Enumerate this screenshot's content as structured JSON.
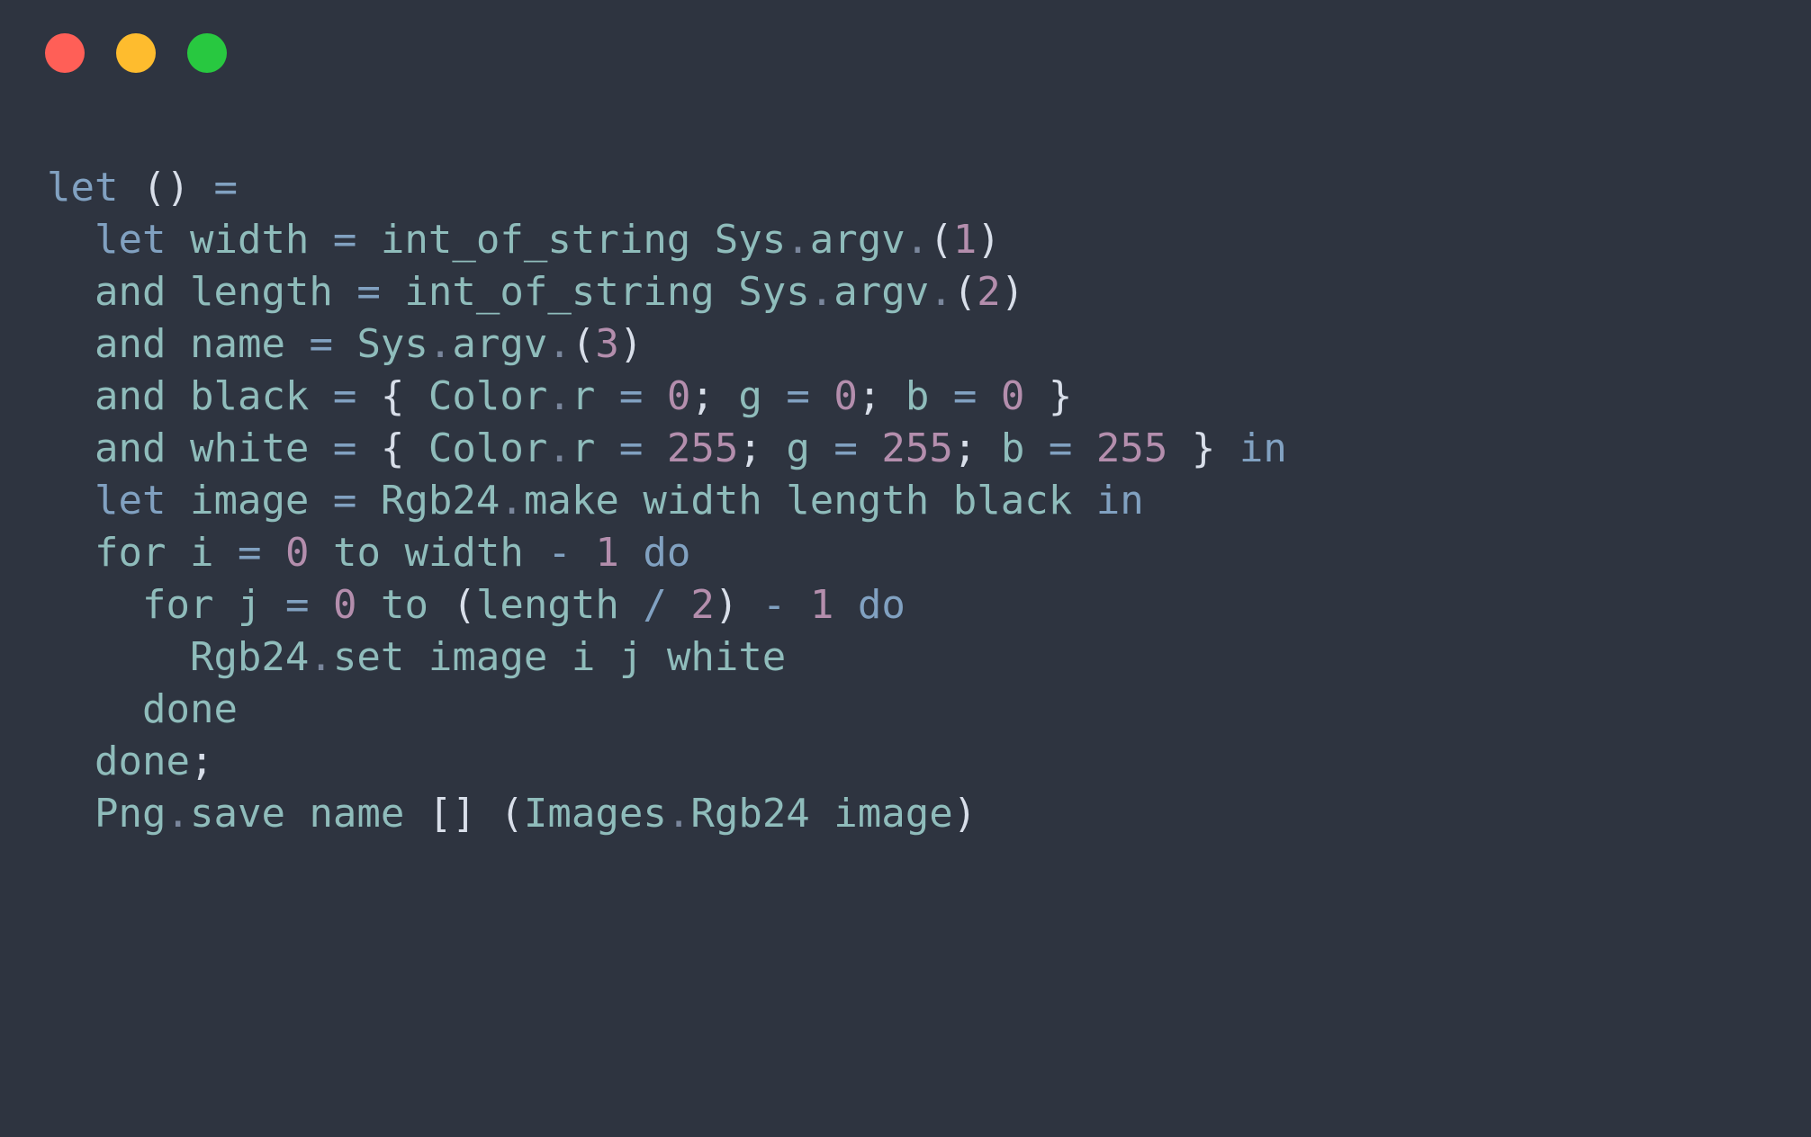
{
  "window": {
    "title": "",
    "background_color": "#2e3440",
    "controls": [
      {
        "name": "close",
        "color": "#ff5f57",
        "label": ""
      },
      {
        "name": "minimize",
        "color": "#febc2e",
        "label": ""
      },
      {
        "name": "maximize",
        "color": "#28c840",
        "label": ""
      }
    ]
  },
  "editor": {
    "language": "OCaml",
    "palette": {
      "background": "#2e3440",
      "keyword": "#81a1c1",
      "identifier": "#8fbcbb",
      "number": "#b48ead",
      "punctuation": "#d8dee9",
      "operator": "#81a1c1"
    },
    "code_plain": "let () =\n  let width = int_of_string Sys.argv.(1)\n  and length = int_of_string Sys.argv.(2)\n  and name = Sys.argv.(3)\n  and black = { Color.r = 0; g = 0; b = 0 }\n  and white = { Color.r = 255; g = 255; b = 255 } in\n  let image = Rgb24.make width length black in\n  for i = 0 to width - 1 do\n    for j = 0 to (length / 2) - 1 do\n      Rgb24.set image i j white\n    done\n  done;\n  Png.save name [] (Images.Rgb24 image)",
    "lines": [
      {
        "n": 1,
        "text": "let () =",
        "tokens": [
          {
            "t": "let",
            "c": "kw"
          },
          {
            "t": " ",
            "c": "plain"
          },
          {
            "t": "()",
            "c": "punc"
          },
          {
            "t": " ",
            "c": "plain"
          },
          {
            "t": "=",
            "c": "op"
          }
        ]
      },
      {
        "n": 2,
        "text": "  let width = int_of_string Sys.argv.(1)",
        "tokens": [
          {
            "t": "  ",
            "c": "plain"
          },
          {
            "t": "let",
            "c": "kw"
          },
          {
            "t": " ",
            "c": "plain"
          },
          {
            "t": "width",
            "c": "id"
          },
          {
            "t": " ",
            "c": "plain"
          },
          {
            "t": "=",
            "c": "op"
          },
          {
            "t": " ",
            "c": "plain"
          },
          {
            "t": "int_of_string",
            "c": "id"
          },
          {
            "t": " ",
            "c": "plain"
          },
          {
            "t": "Sys",
            "c": "id"
          },
          {
            "t": ".",
            "c": "dot"
          },
          {
            "t": "argv",
            "c": "id"
          },
          {
            "t": ".",
            "c": "dot"
          },
          {
            "t": "(",
            "c": "punc"
          },
          {
            "t": "1",
            "c": "num"
          },
          {
            "t": ")",
            "c": "punc"
          }
        ]
      },
      {
        "n": 3,
        "text": "  and length = int_of_string Sys.argv.(2)",
        "tokens": [
          {
            "t": "  ",
            "c": "plain"
          },
          {
            "t": "and",
            "c": "id"
          },
          {
            "t": " ",
            "c": "plain"
          },
          {
            "t": "length",
            "c": "id"
          },
          {
            "t": " ",
            "c": "plain"
          },
          {
            "t": "=",
            "c": "op"
          },
          {
            "t": " ",
            "c": "plain"
          },
          {
            "t": "int_of_string",
            "c": "id"
          },
          {
            "t": " ",
            "c": "plain"
          },
          {
            "t": "Sys",
            "c": "id"
          },
          {
            "t": ".",
            "c": "dot"
          },
          {
            "t": "argv",
            "c": "id"
          },
          {
            "t": ".",
            "c": "dot"
          },
          {
            "t": "(",
            "c": "punc"
          },
          {
            "t": "2",
            "c": "num"
          },
          {
            "t": ")",
            "c": "punc"
          }
        ]
      },
      {
        "n": 4,
        "text": "  and name = Sys.argv.(3)",
        "tokens": [
          {
            "t": "  ",
            "c": "plain"
          },
          {
            "t": "and",
            "c": "id"
          },
          {
            "t": " ",
            "c": "plain"
          },
          {
            "t": "name",
            "c": "id"
          },
          {
            "t": " ",
            "c": "plain"
          },
          {
            "t": "=",
            "c": "op"
          },
          {
            "t": " ",
            "c": "plain"
          },
          {
            "t": "Sys",
            "c": "id"
          },
          {
            "t": ".",
            "c": "dot"
          },
          {
            "t": "argv",
            "c": "id"
          },
          {
            "t": ".",
            "c": "dot"
          },
          {
            "t": "(",
            "c": "punc"
          },
          {
            "t": "3",
            "c": "num"
          },
          {
            "t": ")",
            "c": "punc"
          }
        ]
      },
      {
        "n": 5,
        "text": "  and black = { Color.r = 0; g = 0; b = 0 }",
        "tokens": [
          {
            "t": "  ",
            "c": "plain"
          },
          {
            "t": "and",
            "c": "id"
          },
          {
            "t": " ",
            "c": "plain"
          },
          {
            "t": "black",
            "c": "id"
          },
          {
            "t": " ",
            "c": "plain"
          },
          {
            "t": "=",
            "c": "op"
          },
          {
            "t": " ",
            "c": "plain"
          },
          {
            "t": "{",
            "c": "punc"
          },
          {
            "t": " ",
            "c": "plain"
          },
          {
            "t": "Color",
            "c": "id"
          },
          {
            "t": ".",
            "c": "dot"
          },
          {
            "t": "r",
            "c": "id"
          },
          {
            "t": " ",
            "c": "plain"
          },
          {
            "t": "=",
            "c": "op"
          },
          {
            "t": " ",
            "c": "plain"
          },
          {
            "t": "0",
            "c": "num"
          },
          {
            "t": ";",
            "c": "punc"
          },
          {
            "t": " ",
            "c": "plain"
          },
          {
            "t": "g",
            "c": "id"
          },
          {
            "t": " ",
            "c": "plain"
          },
          {
            "t": "=",
            "c": "op"
          },
          {
            "t": " ",
            "c": "plain"
          },
          {
            "t": "0",
            "c": "num"
          },
          {
            "t": ";",
            "c": "punc"
          },
          {
            "t": " ",
            "c": "plain"
          },
          {
            "t": "b",
            "c": "id"
          },
          {
            "t": " ",
            "c": "plain"
          },
          {
            "t": "=",
            "c": "op"
          },
          {
            "t": " ",
            "c": "plain"
          },
          {
            "t": "0",
            "c": "num"
          },
          {
            "t": " ",
            "c": "plain"
          },
          {
            "t": "}",
            "c": "punc"
          }
        ]
      },
      {
        "n": 6,
        "text": "  and white = { Color.r = 255; g = 255; b = 255 } in",
        "tokens": [
          {
            "t": "  ",
            "c": "plain"
          },
          {
            "t": "and",
            "c": "id"
          },
          {
            "t": " ",
            "c": "plain"
          },
          {
            "t": "white",
            "c": "id"
          },
          {
            "t": " ",
            "c": "plain"
          },
          {
            "t": "=",
            "c": "op"
          },
          {
            "t": " ",
            "c": "plain"
          },
          {
            "t": "{",
            "c": "punc"
          },
          {
            "t": " ",
            "c": "plain"
          },
          {
            "t": "Color",
            "c": "id"
          },
          {
            "t": ".",
            "c": "dot"
          },
          {
            "t": "r",
            "c": "id"
          },
          {
            "t": " ",
            "c": "plain"
          },
          {
            "t": "=",
            "c": "op"
          },
          {
            "t": " ",
            "c": "plain"
          },
          {
            "t": "255",
            "c": "num"
          },
          {
            "t": ";",
            "c": "punc"
          },
          {
            "t": " ",
            "c": "plain"
          },
          {
            "t": "g",
            "c": "id"
          },
          {
            "t": " ",
            "c": "plain"
          },
          {
            "t": "=",
            "c": "op"
          },
          {
            "t": " ",
            "c": "plain"
          },
          {
            "t": "255",
            "c": "num"
          },
          {
            "t": ";",
            "c": "punc"
          },
          {
            "t": " ",
            "c": "plain"
          },
          {
            "t": "b",
            "c": "id"
          },
          {
            "t": " ",
            "c": "plain"
          },
          {
            "t": "=",
            "c": "op"
          },
          {
            "t": " ",
            "c": "plain"
          },
          {
            "t": "255",
            "c": "num"
          },
          {
            "t": " ",
            "c": "plain"
          },
          {
            "t": "}",
            "c": "punc"
          },
          {
            "t": " ",
            "c": "plain"
          },
          {
            "t": "in",
            "c": "kw"
          }
        ]
      },
      {
        "n": 7,
        "text": "  let image = Rgb24.make width length black in",
        "tokens": [
          {
            "t": "  ",
            "c": "plain"
          },
          {
            "t": "let",
            "c": "kw"
          },
          {
            "t": " ",
            "c": "plain"
          },
          {
            "t": "image",
            "c": "id"
          },
          {
            "t": " ",
            "c": "plain"
          },
          {
            "t": "=",
            "c": "op"
          },
          {
            "t": " ",
            "c": "plain"
          },
          {
            "t": "Rgb24",
            "c": "id"
          },
          {
            "t": ".",
            "c": "dot"
          },
          {
            "t": "make",
            "c": "id"
          },
          {
            "t": " ",
            "c": "plain"
          },
          {
            "t": "width",
            "c": "id"
          },
          {
            "t": " ",
            "c": "plain"
          },
          {
            "t": "length",
            "c": "id"
          },
          {
            "t": " ",
            "c": "plain"
          },
          {
            "t": "black",
            "c": "id"
          },
          {
            "t": " ",
            "c": "plain"
          },
          {
            "t": "in",
            "c": "kw"
          }
        ]
      },
      {
        "n": 8,
        "text": "  for i = 0 to width - 1 do",
        "tokens": [
          {
            "t": "  ",
            "c": "plain"
          },
          {
            "t": "for",
            "c": "id"
          },
          {
            "t": " ",
            "c": "plain"
          },
          {
            "t": "i",
            "c": "id"
          },
          {
            "t": " ",
            "c": "plain"
          },
          {
            "t": "=",
            "c": "op"
          },
          {
            "t": " ",
            "c": "plain"
          },
          {
            "t": "0",
            "c": "num"
          },
          {
            "t": " ",
            "c": "plain"
          },
          {
            "t": "to",
            "c": "id"
          },
          {
            "t": " ",
            "c": "plain"
          },
          {
            "t": "width",
            "c": "id"
          },
          {
            "t": " ",
            "c": "plain"
          },
          {
            "t": "-",
            "c": "op"
          },
          {
            "t": " ",
            "c": "plain"
          },
          {
            "t": "1",
            "c": "num"
          },
          {
            "t": " ",
            "c": "plain"
          },
          {
            "t": "do",
            "c": "kw"
          }
        ]
      },
      {
        "n": 9,
        "text": "    for j = 0 to (length / 2) - 1 do",
        "tokens": [
          {
            "t": "    ",
            "c": "plain"
          },
          {
            "t": "for",
            "c": "id"
          },
          {
            "t": " ",
            "c": "plain"
          },
          {
            "t": "j",
            "c": "id"
          },
          {
            "t": " ",
            "c": "plain"
          },
          {
            "t": "=",
            "c": "op"
          },
          {
            "t": " ",
            "c": "plain"
          },
          {
            "t": "0",
            "c": "num"
          },
          {
            "t": " ",
            "c": "plain"
          },
          {
            "t": "to",
            "c": "id"
          },
          {
            "t": " ",
            "c": "plain"
          },
          {
            "t": "(",
            "c": "punc"
          },
          {
            "t": "length",
            "c": "id"
          },
          {
            "t": " ",
            "c": "plain"
          },
          {
            "t": "/",
            "c": "op"
          },
          {
            "t": " ",
            "c": "plain"
          },
          {
            "t": "2",
            "c": "num"
          },
          {
            "t": ")",
            "c": "punc"
          },
          {
            "t": " ",
            "c": "plain"
          },
          {
            "t": "-",
            "c": "op"
          },
          {
            "t": " ",
            "c": "plain"
          },
          {
            "t": "1",
            "c": "num"
          },
          {
            "t": " ",
            "c": "plain"
          },
          {
            "t": "do",
            "c": "kw"
          }
        ]
      },
      {
        "n": 10,
        "text": "      Rgb24.set image i j white",
        "tokens": [
          {
            "t": "      ",
            "c": "plain"
          },
          {
            "t": "Rgb24",
            "c": "id"
          },
          {
            "t": ".",
            "c": "dot"
          },
          {
            "t": "set",
            "c": "id"
          },
          {
            "t": " ",
            "c": "plain"
          },
          {
            "t": "image",
            "c": "id"
          },
          {
            "t": " ",
            "c": "plain"
          },
          {
            "t": "i",
            "c": "id"
          },
          {
            "t": " ",
            "c": "plain"
          },
          {
            "t": "j",
            "c": "id"
          },
          {
            "t": " ",
            "c": "plain"
          },
          {
            "t": "white",
            "c": "id"
          }
        ]
      },
      {
        "n": 11,
        "text": "    done",
        "tokens": [
          {
            "t": "    ",
            "c": "plain"
          },
          {
            "t": "done",
            "c": "id"
          }
        ]
      },
      {
        "n": 12,
        "text": "  done;",
        "tokens": [
          {
            "t": "  ",
            "c": "plain"
          },
          {
            "t": "done",
            "c": "id"
          },
          {
            "t": ";",
            "c": "punc"
          }
        ]
      },
      {
        "n": 13,
        "text": "  Png.save name [] (Images.Rgb24 image)",
        "tokens": [
          {
            "t": "  ",
            "c": "plain"
          },
          {
            "t": "Png",
            "c": "id"
          },
          {
            "t": ".",
            "c": "dot"
          },
          {
            "t": "save",
            "c": "id"
          },
          {
            "t": " ",
            "c": "plain"
          },
          {
            "t": "name",
            "c": "id"
          },
          {
            "t": " ",
            "c": "plain"
          },
          {
            "t": "[]",
            "c": "punc"
          },
          {
            "t": " ",
            "c": "plain"
          },
          {
            "t": "(",
            "c": "punc"
          },
          {
            "t": "Images",
            "c": "id"
          },
          {
            "t": ".",
            "c": "dot"
          },
          {
            "t": "Rgb24",
            "c": "id"
          },
          {
            "t": " ",
            "c": "plain"
          },
          {
            "t": "image",
            "c": "id"
          },
          {
            "t": ")",
            "c": "punc"
          }
        ]
      }
    ]
  }
}
